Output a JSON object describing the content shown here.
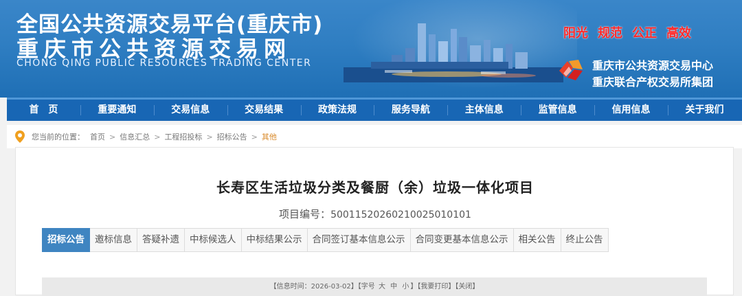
{
  "header": {
    "title_line1": "全国公共资源交易平台(重庆市)",
    "title_line2": "重庆市公共资源交易网",
    "title_en": "CHONG QING PUBLIC RESOURCES TRADING CENTER",
    "slogans": [
      "阳光",
      "规范",
      "公正",
      "高效"
    ],
    "org1": "重庆市公共资源交易中心",
    "org2": "重庆联合产权交易所集团"
  },
  "nav": [
    "首　页",
    "重要通知",
    "交易信息",
    "交易结果",
    "政策法规",
    "服务导航",
    "主体信息",
    "监管信息",
    "信用信息",
    "关于我们"
  ],
  "breadcrumb": {
    "prefix": "您当前的位置：",
    "items": [
      "首页",
      "信息汇总",
      "工程招投标",
      "招标公告",
      "其他"
    ],
    "separator": ">"
  },
  "article": {
    "title": "长寿区生活垃圾分类及餐厨（余）垃圾一体化项目",
    "code_label": "项目编号：",
    "code_value": "500115202602100250101​01",
    "tabs": [
      "招标公告",
      "邀标信息",
      "答疑补遗",
      "中标候选人",
      "中标结果公示",
      "合同签订基本信息公示",
      "合同变更基本信息公示",
      "相关公告",
      "终止公告"
    ],
    "active_tab": 0,
    "info": {
      "time_label": "【信息时间：",
      "time_value": "2026-03-02",
      "time_close": "】",
      "font_prefix": "【字号",
      "font_large": "大",
      "font_mid": "中",
      "font_small": "小",
      "font_close": "】",
      "print": "【我要打印】",
      "close": "【关闭】"
    }
  },
  "colors": {
    "nav_bg": "#1866b4",
    "active_tab": "#3f85c1",
    "slogan": "#ff2a2a",
    "crumb_current": "#d98a2b"
  }
}
